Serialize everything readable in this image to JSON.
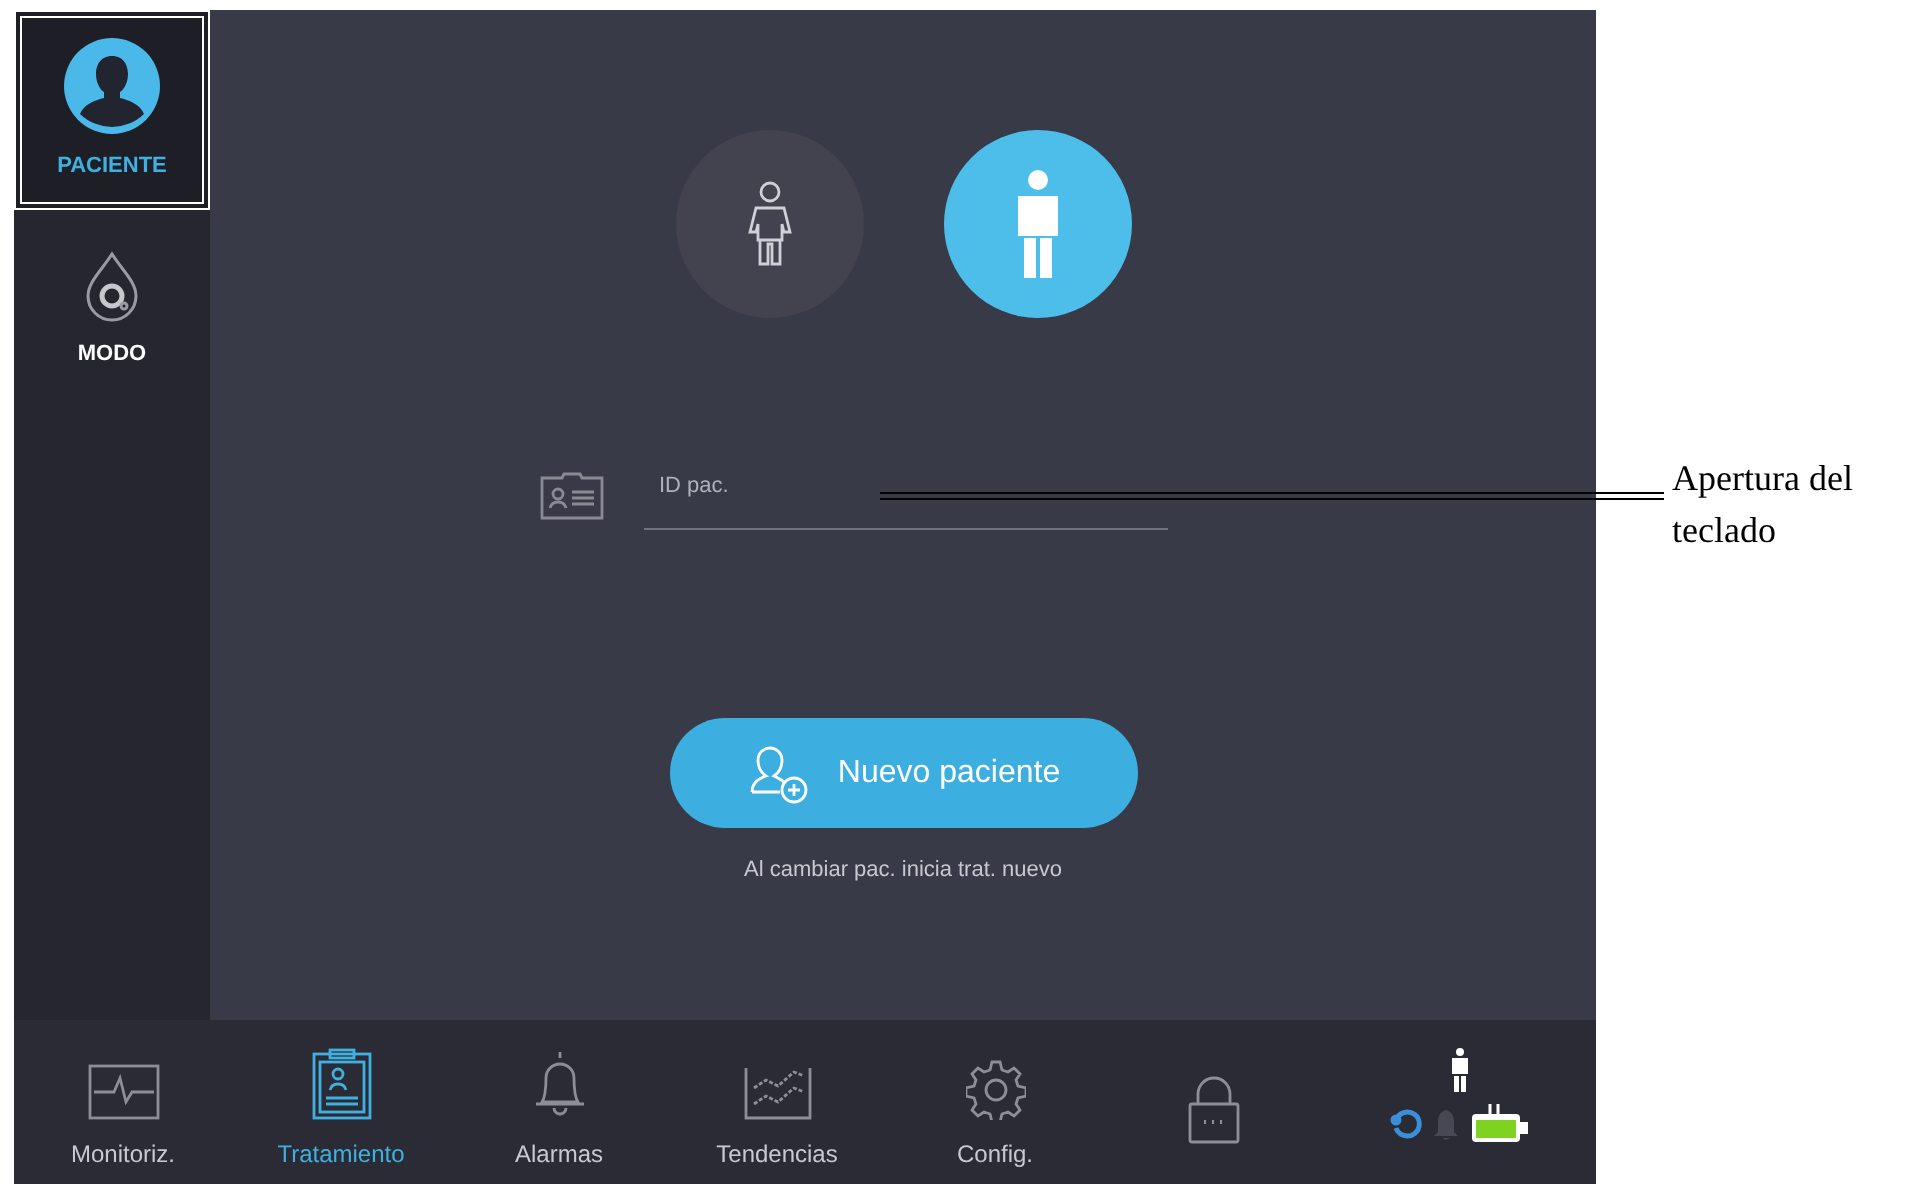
{
  "sidebar": {
    "items": [
      {
        "label": "PACIENTE",
        "kind": "patient",
        "selected": true
      },
      {
        "label": "MODO",
        "kind": "mode",
        "selected": false
      }
    ]
  },
  "patient_types": [
    {
      "kind": "child",
      "selected": false
    },
    {
      "kind": "adult",
      "selected": true
    }
  ],
  "id_field": {
    "placeholder": "ID pac."
  },
  "new_patient_button": {
    "label": "Nuevo paciente"
  },
  "hint": "Al cambiar pac. inicia trat. nuevo",
  "nav": [
    {
      "label": "Monitoriz.",
      "kind": "monitor",
      "selected": false
    },
    {
      "label": "Tratamiento",
      "kind": "treatment",
      "selected": true
    },
    {
      "label": "Alarmas",
      "kind": "alarms",
      "selected": false
    },
    {
      "label": "Tendencias",
      "kind": "trends",
      "selected": false
    },
    {
      "label": "Config.",
      "kind": "config",
      "selected": false
    },
    {
      "kind": "lock",
      "selected": false
    }
  ],
  "annotation": {
    "text": "Apertura del teclado"
  }
}
